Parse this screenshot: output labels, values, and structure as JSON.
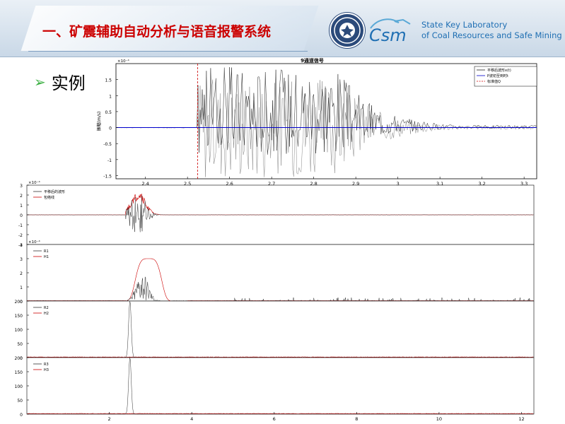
{
  "header": {
    "title": "一、矿震辅助自动分析与语音报警系统",
    "lab_name_line1": "State Key Laboratory",
    "lab_name_line2": "of Coal Resources and Safe Mining",
    "accent_color": "#cc0000",
    "lab_color": "#1f6fb3"
  },
  "section": {
    "title": "实例",
    "bullet_icon": "arrow-bullet-icon"
  },
  "chart_data": [
    {
      "type": "line",
      "title": "9通道信号",
      "ylabel": "振幅(m/s)",
      "y_exponent": "×10⁻⁴",
      "x_ticks": [
        "2.4",
        "2.5",
        "2.6",
        "2.7",
        "2.8",
        "2.9",
        "3",
        "3.1",
        "3.2",
        "3.3"
      ],
      "x_ticks_values": [
        2.4,
        2.5,
        2.6,
        2.7,
        2.8,
        2.9,
        3.0,
        3.1,
        3.2,
        3.3
      ],
      "y_ticks": [
        "1.5",
        "1",
        "0.5",
        "0",
        "-0.5",
        "-1",
        "-1.5"
      ],
      "y_ticks_values": [
        1.5,
        1.0,
        0.5,
        0.0,
        -0.5,
        -1.0,
        -1.5
      ],
      "xlim": [
        2.33,
        3.33
      ],
      "ylim": [
        -1.6,
        2.0
      ],
      "onset_x": 2.524,
      "legend": [
        "平移后波形x(t)",
        "P波初至到时t",
        "标准值Q"
      ],
      "series_colors": [
        "#888888",
        "#222222",
        "#0000cc",
        "#cc0000"
      ]
    },
    {
      "type": "line",
      "y_exponent": "×10⁻⁴",
      "y_ticks": [
        "3",
        "2",
        "1",
        "0",
        "-1",
        "-2",
        "-3"
      ],
      "y_ticks_values": [
        3,
        2,
        1,
        0,
        -1,
        -2,
        -3
      ],
      "ylim": [
        -3,
        3
      ],
      "xlim": [
        0,
        12.3
      ],
      "legend": [
        "平移后的波形",
        "包络线"
      ],
      "series_colors": [
        "#333333",
        "#cc0000"
      ]
    },
    {
      "type": "line",
      "y_exponent": "×10⁻⁴",
      "y_ticks": [
        "4",
        "3",
        "2",
        "1",
        "0"
      ],
      "y_ticks_values": [
        4,
        3,
        2,
        1,
        0
      ],
      "ylim": [
        0,
        4
      ],
      "xlim": [
        0,
        12.3
      ],
      "legend": [
        "R1",
        "H1"
      ],
      "series_colors": [
        "#333333",
        "#cc0000"
      ]
    },
    {
      "type": "line",
      "y_ticks": [
        "200",
        "150",
        "100",
        "50",
        "0"
      ],
      "y_ticks_values": [
        200,
        150,
        100,
        50,
        0
      ],
      "ylim": [
        0,
        200
      ],
      "xlim": [
        0,
        12.3
      ],
      "legend": [
        "R2",
        "H2"
      ],
      "series_colors": [
        "#333333",
        "#cc0000"
      ]
    },
    {
      "type": "line",
      "x_ticks": [
        "2",
        "4",
        "6",
        "8",
        "10",
        "12"
      ],
      "x_ticks_values": [
        2,
        4,
        6,
        8,
        10,
        12
      ],
      "y_ticks": [
        "200",
        "150",
        "100",
        "50",
        "0"
      ],
      "y_ticks_values": [
        200,
        150,
        100,
        50,
        0
      ],
      "ylim": [
        0,
        200
      ],
      "xlim": [
        0,
        12.3
      ],
      "legend": [
        "R3",
        "H3"
      ],
      "series_colors": [
        "#333333",
        "#cc0000"
      ]
    }
  ]
}
